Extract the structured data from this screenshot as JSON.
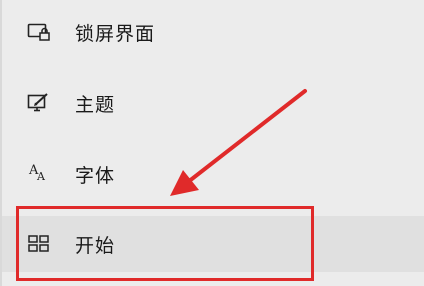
{
  "settings_nav": {
    "items": [
      {
        "label": "锁屏界面",
        "icon": "lock-screen-icon"
      },
      {
        "label": "主题",
        "icon": "theme-brush-icon"
      },
      {
        "label": "字体",
        "icon": "font-icon",
        "icon_glyph": "AA"
      },
      {
        "label": "开始",
        "icon": "start-grid-icon",
        "selected": true
      }
    ]
  },
  "annotation": {
    "highlight_color": "#e02a2a",
    "arrow_color": "#e02a2a"
  }
}
